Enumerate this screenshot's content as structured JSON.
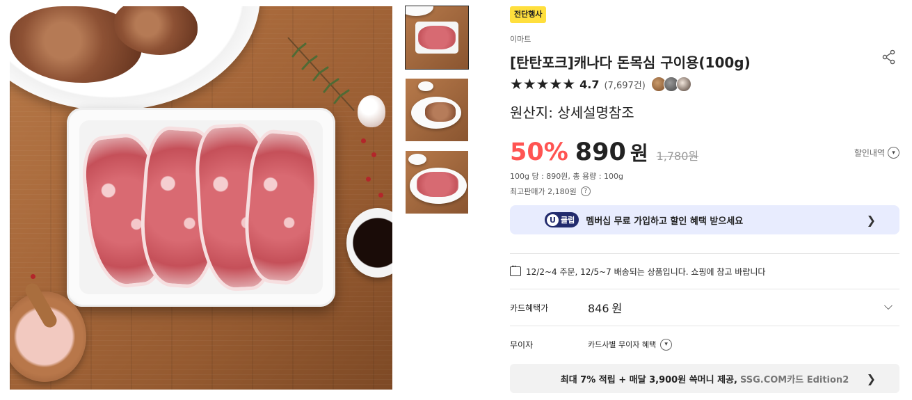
{
  "product": {
    "badge": "전단행사",
    "seller": "이마트",
    "title": "[탄탄포크]캐나다 돈목심 구이용(100g)",
    "rating": "4.7",
    "review_count": "(7,697건)",
    "origin": "원산지: 상세설명참조"
  },
  "price": {
    "discount": "50%",
    "value": "890",
    "currency": "원",
    "original": "1,780원",
    "discount_detail_label": "할인내역",
    "unit_price": "100g 당 : 890원, 총 용량 : 100g",
    "max_price": "최고판매가 2,180원"
  },
  "membership": {
    "badge_letter": "U",
    "badge_text": "클럽",
    "text": "멤버십 무료 가입하고 할인 혜택 받으세요"
  },
  "shipping": {
    "text": "12/2~4 주문, 12/5~7 배송되는 상품입니다. 쇼핑에 참고 바랍니다"
  },
  "card_benefit": {
    "label": "카드혜택가",
    "value": "846",
    "unit": "원"
  },
  "installment": {
    "label": "무이자",
    "value": "카드사별 무이자 혜택"
  },
  "promo": {
    "text": "최대 7% 적립 + 매달 3,900원 쓱머니 제공,",
    "card": "SSG.COM카드 Edition2"
  },
  "colors": {
    "badge_bg": "#ffdf3d",
    "discount": "#ff5452",
    "member_banner_bg": "#e8ecfe",
    "uclub_bg": "#222b6d",
    "promo_bg": "#f2f2f2"
  },
  "icons": [
    "share-icon",
    "star-icon",
    "chevron-down-icon",
    "chevron-right-icon",
    "question-icon",
    "chat-icon"
  ]
}
